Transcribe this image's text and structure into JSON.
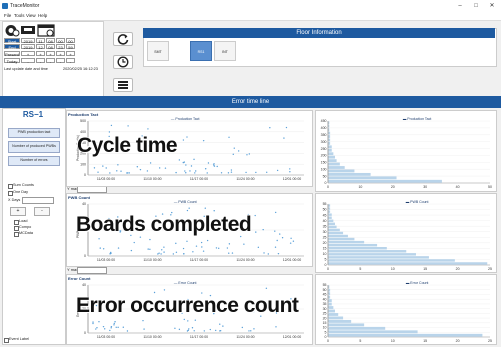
{
  "window": {
    "title": "TraceMonitor",
    "controls": [
      "–",
      "□",
      "✕"
    ]
  },
  "menu": [
    "File",
    "Tools",
    "View",
    "Help"
  ],
  "time_table": {
    "rows": [
      {
        "label": "Start",
        "values": [
          "2019",
          "11",
          "08",
          "00",
          "00"
        ]
      },
      {
        "label": "End",
        "values": [
          "2019",
          "12",
          "08",
          "23",
          "59"
        ]
      },
      {
        "label": "Present",
        "values": [
          "+",
          "+",
          "+",
          "+",
          "+"
        ]
      },
      {
        "label": "Today",
        "values": [
          "-",
          "-",
          "-",
          "-",
          "-"
        ]
      }
    ],
    "last_update_label": "Last update date and time",
    "last_update_value": "2020/02/25 16:12:23"
  },
  "floor": {
    "title": "Floor Information",
    "items": [
      "SMT",
      "RS1",
      "INT"
    ]
  },
  "error_timeline": {
    "title": "Error time line"
  },
  "left": {
    "rs_title": "RS−1",
    "buttons": [
      "PWB production tact",
      "Number of produced PWBs",
      "Number of errors"
    ],
    "checks": [
      "Sum Counts",
      "One Day"
    ],
    "xdays_label": "X Days",
    "plus": "+",
    "minus": "-",
    "tree": [
      "Load",
      "Compo",
      "MCData"
    ],
    "event_label": "Event Label"
  },
  "charts": {
    "production": {
      "left_title": "Production Tact",
      "legend": "Production Tact",
      "overlay": "Cycle time",
      "ylabel": "Production Tact(s)",
      "yticks": [
        "0",
        "100",
        "200",
        "300",
        "400",
        "500"
      ],
      "xticks": [
        "11/03 00:00",
        "11/10 00:00",
        "11/17 00:00",
        "11/24 00:00",
        "12/01 00:00"
      ],
      "hist_yticks": [
        "0",
        "50",
        "100",
        "150",
        "200",
        "250",
        "300",
        "350",
        "400",
        "450"
      ],
      "hist_xticks": [
        "0",
        "10",
        "20",
        "30",
        "40",
        "50"
      ]
    },
    "pwb": {
      "left_title": "PWB Count",
      "legend": "PWB Count",
      "overlay": "Boards completed",
      "ylabel": "PWB count",
      "yticks": [
        "0",
        "20",
        "40"
      ],
      "xticks": [
        "11/03 00:00",
        "11/10 00:00",
        "11/17 00:00",
        "11/24 00:00",
        "12/01 00:00"
      ],
      "hist_yticks": [
        "0",
        "5",
        "10",
        "15",
        "20",
        "25",
        "30",
        "35",
        "40",
        "45",
        "50",
        "55"
      ],
      "hist_xticks": [
        "0",
        "5",
        "10",
        "15",
        "20",
        "25"
      ]
    },
    "error": {
      "left_title": "Error Count",
      "legend": "Error Count",
      "overlay": "Error occurrence count",
      "ylabel": "Error count",
      "yticks": [
        "0",
        "20",
        "40"
      ],
      "xticks": [
        "11/03 00:00",
        "11/10 00:00",
        "11/17 00:00",
        "11/24 00:00",
        "12/01 00:00"
      ],
      "hist_yticks": [
        "0",
        "5",
        "10",
        "15",
        "20",
        "25",
        "30",
        "35",
        "40",
        "45",
        "50",
        "55"
      ],
      "hist_xticks": [
        "0",
        "5",
        "10",
        "15",
        "20",
        "25"
      ]
    },
    "ymax_label": "Y max"
  },
  "colors": {
    "accent": "#1e5aa0",
    "points": "#5aa0d8",
    "bars": "#b9d4ea"
  }
}
